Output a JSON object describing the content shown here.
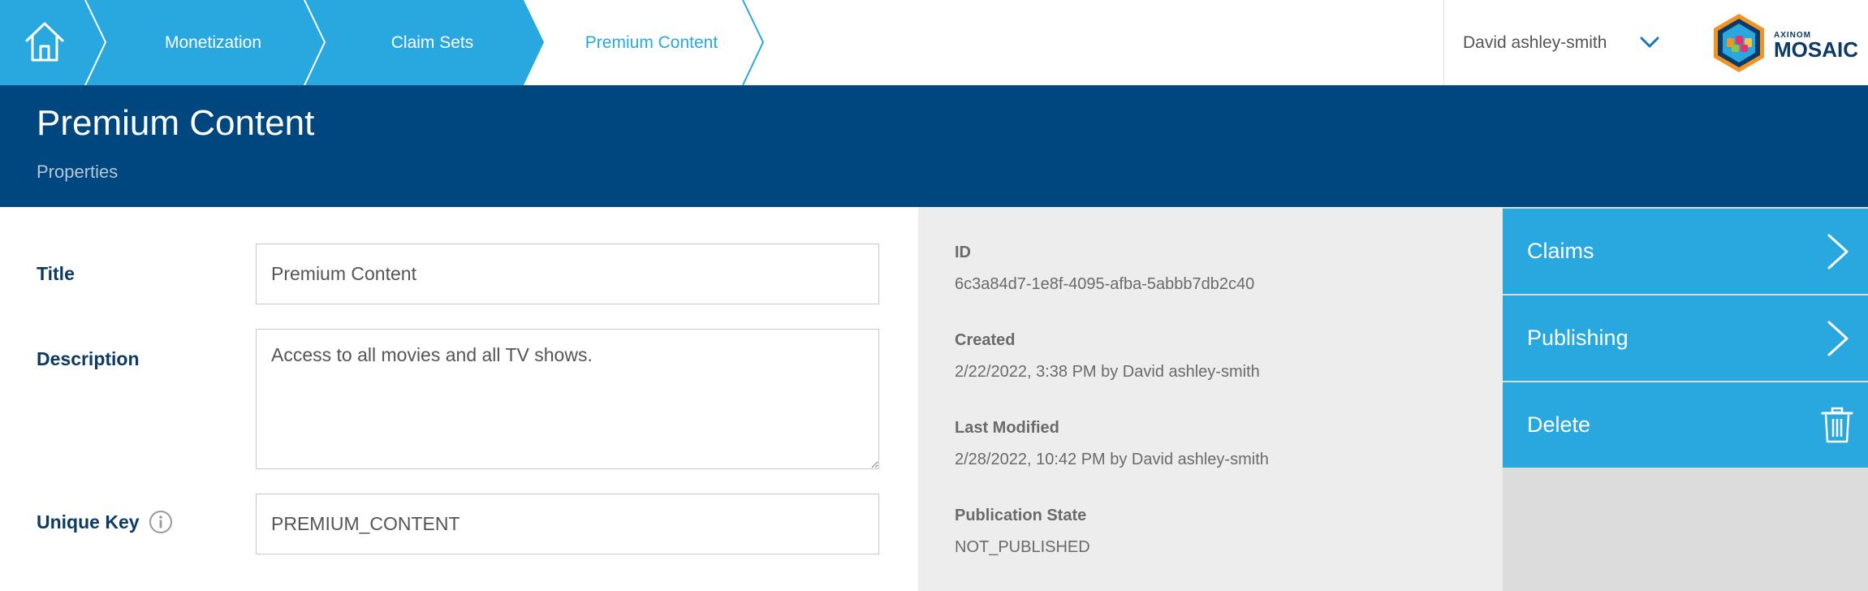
{
  "breadcrumb": {
    "items": [
      {
        "label": "Monetization"
      },
      {
        "label": "Claim Sets"
      },
      {
        "label": "Premium Content"
      }
    ]
  },
  "user": {
    "name": "David ashley-smith"
  },
  "logo": {
    "small": "AXINOM",
    "big": "MOSAIC"
  },
  "header": {
    "title": "Premium Content",
    "subtitle": "Properties"
  },
  "form": {
    "title": {
      "label": "Title",
      "value": "Premium Content"
    },
    "description": {
      "label": "Description",
      "value": "Access to all movies and all TV shows."
    },
    "unique_key": {
      "label": "Unique Key",
      "value": "PREMIUM_CONTENT"
    }
  },
  "details": {
    "id": {
      "label": "ID",
      "value": "6c3a84d7-1e8f-4095-afba-5abbb7db2c40"
    },
    "created": {
      "label": "Created",
      "value": "2/22/2022, 3:38 PM by David ashley-smith"
    },
    "modified": {
      "label": "Last Modified",
      "value": "2/28/2022, 10:42 PM by David ashley-smith"
    },
    "state": {
      "label": "Publication State",
      "value": "NOT_PUBLISHED"
    }
  },
  "actions": [
    {
      "label": "Claims",
      "icon": "chevron-right-icon"
    },
    {
      "label": "Publishing",
      "icon": "chevron-right-icon"
    },
    {
      "label": "Delete",
      "icon": "trash-icon"
    }
  ],
  "colors": {
    "accent": "#29a8e0",
    "header_band": "#00467f",
    "label_text": "#0b3a64",
    "details_bg": "#ededed",
    "actions_bg": "#dcdcdc"
  }
}
